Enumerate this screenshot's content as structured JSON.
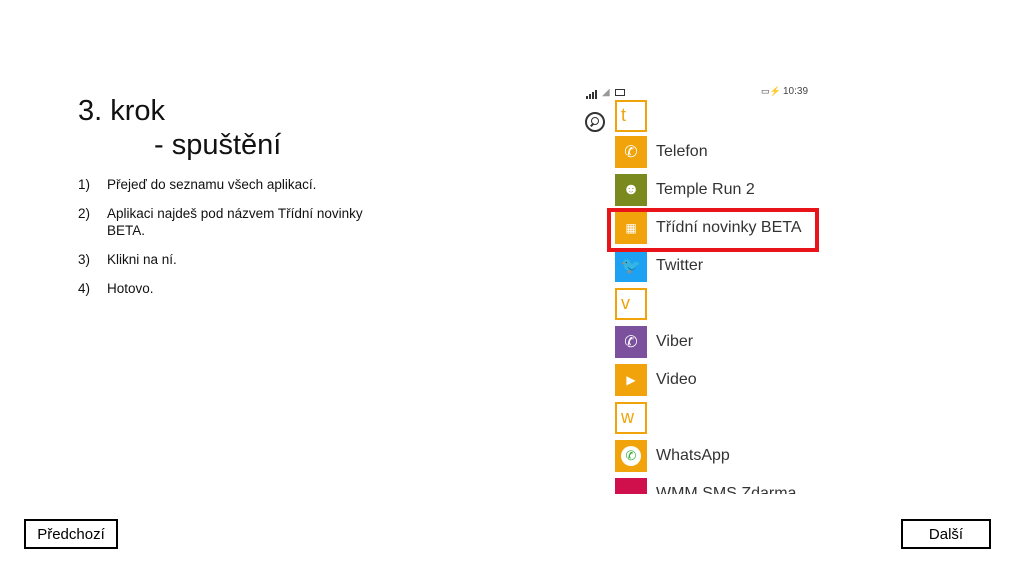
{
  "slide": {
    "title_line1": "3. krok",
    "title_line2": "- spuštění",
    "steps": [
      {
        "num": "1)",
        "text": "Přejeď do seznamu všech aplikací."
      },
      {
        "num": "2)",
        "text": "Aplikaci najdeš pod názvem Třídní novinky BETA."
      },
      {
        "num": "3)",
        "text": "Klikni na ní."
      },
      {
        "num": "4)",
        "text": "Hotovo."
      }
    ],
    "prev_label": "Předchozí",
    "next_label": "Další"
  },
  "phone": {
    "status": {
      "time": "10:39",
      "battery_icon": "battery-charging-icon"
    },
    "apps": [
      {
        "type": "letter",
        "text": "t"
      },
      {
        "type": "app",
        "name": "Telefon",
        "icon": "phone-icon",
        "color": "#f0a30a"
      },
      {
        "type": "app",
        "name": "Temple Run 2",
        "icon": "temple-run-icon",
        "color": "#7a8a1e"
      },
      {
        "type": "app",
        "name": "Třídní novinky BETA",
        "icon": "school-icon",
        "color": "#f0a30a"
      },
      {
        "type": "app",
        "name": "Twitter",
        "icon": "twitter-bird-icon",
        "color": "#1da1f2"
      },
      {
        "type": "letter",
        "text": "v"
      },
      {
        "type": "app",
        "name": "Viber",
        "icon": "viber-icon",
        "color": "#7b519d"
      },
      {
        "type": "app",
        "name": "Video",
        "icon": "video-icon",
        "color": "#f0a30a"
      },
      {
        "type": "letter",
        "text": "w"
      },
      {
        "type": "app",
        "name": "WhatsApp",
        "icon": "whatsapp-icon",
        "color": "#f0a30a"
      },
      {
        "type": "app",
        "name": "WMM SMS Zdarma",
        "icon": "wmm-sms-icon",
        "color": "#d00f4d"
      }
    ]
  }
}
